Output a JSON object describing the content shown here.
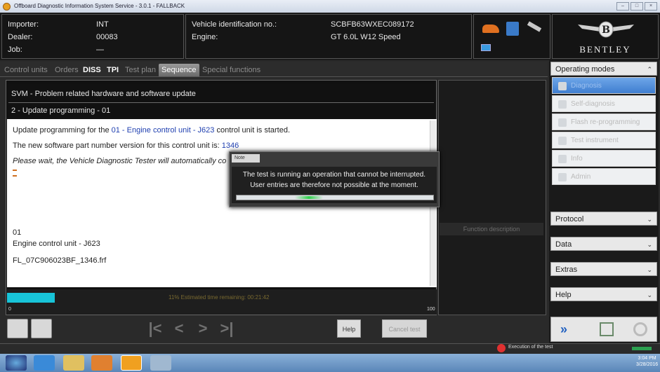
{
  "window": {
    "title": "Offboard Diagnostic Information System Service - 3.0.1 - FALLBACK",
    "controls": [
      "–",
      "□",
      "×"
    ]
  },
  "header": {
    "importer_label": "Importer:",
    "importer_value": "INT",
    "dealer_label": "Dealer:",
    "dealer_value": "00083",
    "job_label": "Job:",
    "job_value": "—",
    "vin_label": "Vehicle identification no.:",
    "vin_value": "SCBFB63WXEC089172",
    "engine_label": "Engine:",
    "engine_value": "GT 6.0L W12 Speed",
    "brand": "BENTLEY"
  },
  "tabs": [
    "Control units",
    "Orders",
    "DISS",
    "TPI",
    "Test plan",
    "Sequence",
    "Special functions"
  ],
  "svm": {
    "line1": "SVM - Problem related hardware and software update",
    "line2": "2 - Update programming - 01"
  },
  "message": {
    "l1_a": "Update programming for the ",
    "l1_b": "01 - Engine control unit - J623",
    "l1_c": "  control unit is started.",
    "l2_a": "The new software part number version for this control unit is: ",
    "l2_b": "1346",
    "l3": "Please wait, the Vehicle Diagnostic Tester will automatically co",
    "info1": "01",
    "info2": "Engine control unit - J623",
    "info3": "FL_07C906023BF_1346.frf"
  },
  "progress": {
    "percent_value": 11,
    "text": "11% Estimated time remaining: 00:21:42",
    "min": "0",
    "max": "100"
  },
  "function_description": "Function description",
  "toolbar": {
    "help": "Help",
    "cancel": "Cancel test"
  },
  "sidebar": {
    "operating_modes": "Operating modes",
    "modes": [
      "Diagnosis",
      "Self-diagnosis",
      "Flash re-programming",
      "Test instrument",
      "Info",
      "Admin"
    ],
    "protocol": "Protocol",
    "data": "Data",
    "extras": "Extras",
    "help": "Help"
  },
  "modal": {
    "title": "Note",
    "line1": "The test is running an operation that cannot be interrupted.",
    "line2": "User entries are therefore not possible at the moment."
  },
  "status": {
    "text": "Execution of the test"
  },
  "taskbar": {
    "time": "3:04 PM",
    "date": "3/28/2016"
  },
  "colors": {
    "progress": "#18c4d8",
    "selected_mode": "#3f7ed0",
    "link": "#2040b0"
  }
}
